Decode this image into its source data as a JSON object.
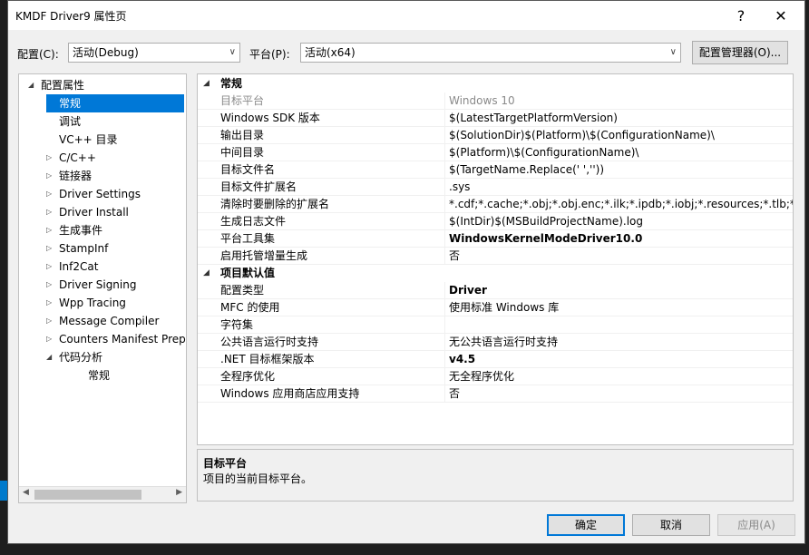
{
  "window": {
    "title": "KMDF Driver9 属性页",
    "help": "?",
    "close": "✕"
  },
  "config": {
    "label": "配置(C):",
    "value": "活动(Debug)",
    "platform_label": "平台(P):",
    "platform_value": "活动(x64)",
    "manager_button": "配置管理器(O)..."
  },
  "tree": {
    "nodes": [
      {
        "label": "配置属性",
        "state": "expanded"
      },
      {
        "label": "常规",
        "state": "selected"
      },
      {
        "label": "调试"
      },
      {
        "label": "VC++ 目录"
      },
      {
        "label": "C/C++",
        "state": "collapsed"
      },
      {
        "label": "链接器",
        "state": "collapsed"
      },
      {
        "label": "Driver Settings",
        "state": "collapsed"
      },
      {
        "label": "Driver Install",
        "state": "collapsed"
      },
      {
        "label": "生成事件",
        "state": "collapsed"
      },
      {
        "label": "StampInf",
        "state": "collapsed"
      },
      {
        "label": "Inf2Cat",
        "state": "collapsed"
      },
      {
        "label": "Driver Signing",
        "state": "collapsed"
      },
      {
        "label": "Wpp Tracing",
        "state": "collapsed"
      },
      {
        "label": "Message Compiler",
        "state": "collapsed"
      },
      {
        "label": "Counters Manifest Preprocessor",
        "state": "collapsed"
      },
      {
        "label": "代码分析",
        "state": "expanded"
      },
      {
        "label": "常规"
      }
    ]
  },
  "grid": {
    "cat1": "常规",
    "rows1": [
      {
        "name": "目标平台",
        "value": "Windows 10",
        "dim": true
      },
      {
        "name": "Windows SDK 版本",
        "value": "$(LatestTargetPlatformVersion)"
      },
      {
        "name": "输出目录",
        "value": "$(SolutionDir)$(Platform)\\$(ConfigurationName)\\"
      },
      {
        "name": "中间目录",
        "value": "$(Platform)\\$(ConfigurationName)\\"
      },
      {
        "name": "目标文件名",
        "value": "$(TargetName.Replace(' ',''))"
      },
      {
        "name": "目标文件扩展名",
        "value": ".sys"
      },
      {
        "name": "清除时要删除的扩展名",
        "value": "*.cdf;*.cache;*.obj;*.obj.enc;*.ilk;*.ipdb;*.iobj;*.resources;*.tlb;*.tli;*.tlh"
      },
      {
        "name": "生成日志文件",
        "value": "$(IntDir)$(MSBuildProjectName).log"
      },
      {
        "name": "平台工具集",
        "value": "WindowsKernelModeDriver10.0",
        "bold": true
      },
      {
        "name": "启用托管增量生成",
        "value": "否"
      }
    ],
    "cat2": "项目默认值",
    "rows2": [
      {
        "name": "配置类型",
        "value": "Driver",
        "bold": true
      },
      {
        "name": "MFC 的使用",
        "value": "使用标准 Windows 库"
      },
      {
        "name": "字符集",
        "value": ""
      },
      {
        "name": "公共语言运行时支持",
        "value": "无公共语言运行时支持"
      },
      {
        "name": ".NET 目标框架版本",
        "value": "v4.5",
        "bold": true
      },
      {
        "name": "全程序优化",
        "value": "无全程序优化"
      },
      {
        "name": "Windows 应用商店应用支持",
        "value": "否"
      }
    ]
  },
  "description": {
    "title": "目标平台",
    "text": "项目的当前目标平台。"
  },
  "buttons": {
    "ok": "确定",
    "cancel": "取消",
    "apply": "应用(A)"
  },
  "colors": {
    "accent": "#0078d7",
    "dim": "#8a8a8a"
  }
}
